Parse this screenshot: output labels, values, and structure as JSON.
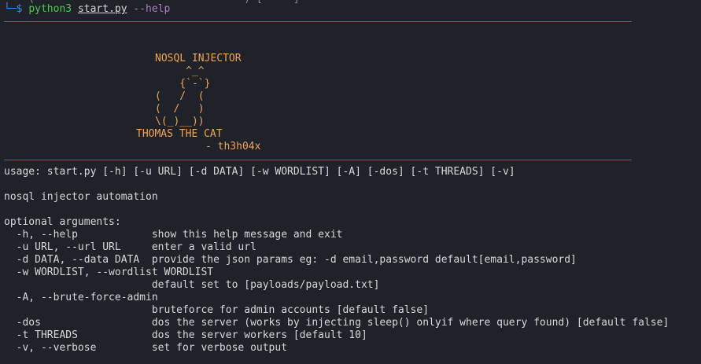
{
  "prompt": {
    "top_partial": "  ──(                                  )─[     ]",
    "corner": "└─",
    "dollar": "$",
    "command": "python3",
    "script": "start.py",
    "flag": "--help"
  },
  "banner": {
    "title": "NOSQL INJECTOR",
    "art": [
      "     ^_^",
      "    {`-`}",
      "(   /  (",
      "(  /   )",
      "\\(_)__))"
    ],
    "cat_name": "THOMAS THE CAT",
    "author": "- th3h04x"
  },
  "help": {
    "usage": "usage: start.py [-h] [-u URL] [-d DATA] [-w WORDLIST] [-A] [-dos] [-t THREADS] [-v]",
    "description": "nosql injector automation",
    "section": "optional arguments:",
    "options": [
      "  -h, --help            show this help message and exit",
      "  -u URL, --url URL     enter a valid url",
      "  -d DATA, --data DATA  provide the json params eg: -d email,password default[email,password]",
      "  -w WORDLIST, --wordlist WORDLIST",
      "                        default set to [payloads/payload.txt]",
      "  -A, --brute-force-admin",
      "                        bruteforce for admin accounts [default false]",
      "  -dos                  dos the server (works by injecting sleep() onlyif where query found) [default false]",
      "  -t THREADS            dos the server workers [default 10]",
      "  -v, --verbose         set for verbose output"
    ]
  },
  "colors": {
    "background": "#1f2229",
    "rule": "#3b6ab8",
    "banner": "#f0a35a",
    "prompt": "#3b8eea",
    "command": "#4ec94e",
    "flag": "#b07cc8",
    "text": "#d8d8d8"
  }
}
